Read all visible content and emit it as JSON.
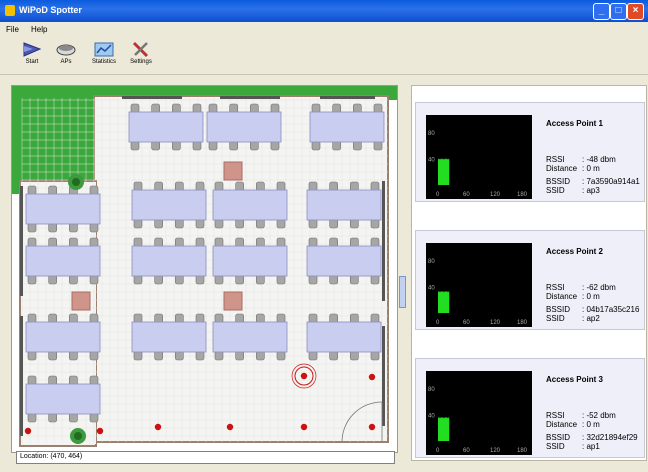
{
  "window": {
    "title": "WiPoD Spotter"
  },
  "menu": {
    "file": "File",
    "help": "Help"
  },
  "toolbar": {
    "start": "Start",
    "aps": "APs",
    "statistics": "Statistics",
    "settings": "Settings"
  },
  "map": {
    "location": "Location: (470, 464)"
  },
  "access_points": [
    {
      "title": "Access Point 1",
      "rssi_label": "RSSI",
      "rssi": ": -48 dbm",
      "distance_label": "Distance",
      "distance": ": 0 m",
      "bssid_label": "BSSID",
      "bssid": ": 7a3590a914a1",
      "ssid_label": "SSID",
      "ssid": ": ap3"
    },
    {
      "title": "Access Point 2",
      "rssi_label": "RSSI",
      "rssi": ": -62 dbm",
      "distance_label": "Distance",
      "distance": ": 0 m",
      "bssid_label": "BSSID",
      "bssid": ": 04b17a35c216",
      "ssid_label": "SSID",
      "ssid": ": ap2"
    },
    {
      "title": "Access Point 3",
      "rssi_label": "RSSI",
      "rssi": ": -52 dbm",
      "distance_label": "Distance",
      "distance": ": 0 m",
      "bssid_label": "BSSID",
      "bssid": ": 32d21894ef29",
      "ssid_label": "SSID",
      "ssid": ": ap1"
    }
  ],
  "graph": {
    "y_ticks": [
      "80",
      "40"
    ],
    "x_ticks": [
      "0",
      "60",
      "120",
      "180"
    ],
    "levels": [
      40,
      33,
      36
    ]
  },
  "colors": {
    "signal": "#22dd22",
    "graph_bg": "#000000",
    "sensor": "#cc1111",
    "table": "#c9cdf0",
    "grass": "#3aa83a"
  }
}
